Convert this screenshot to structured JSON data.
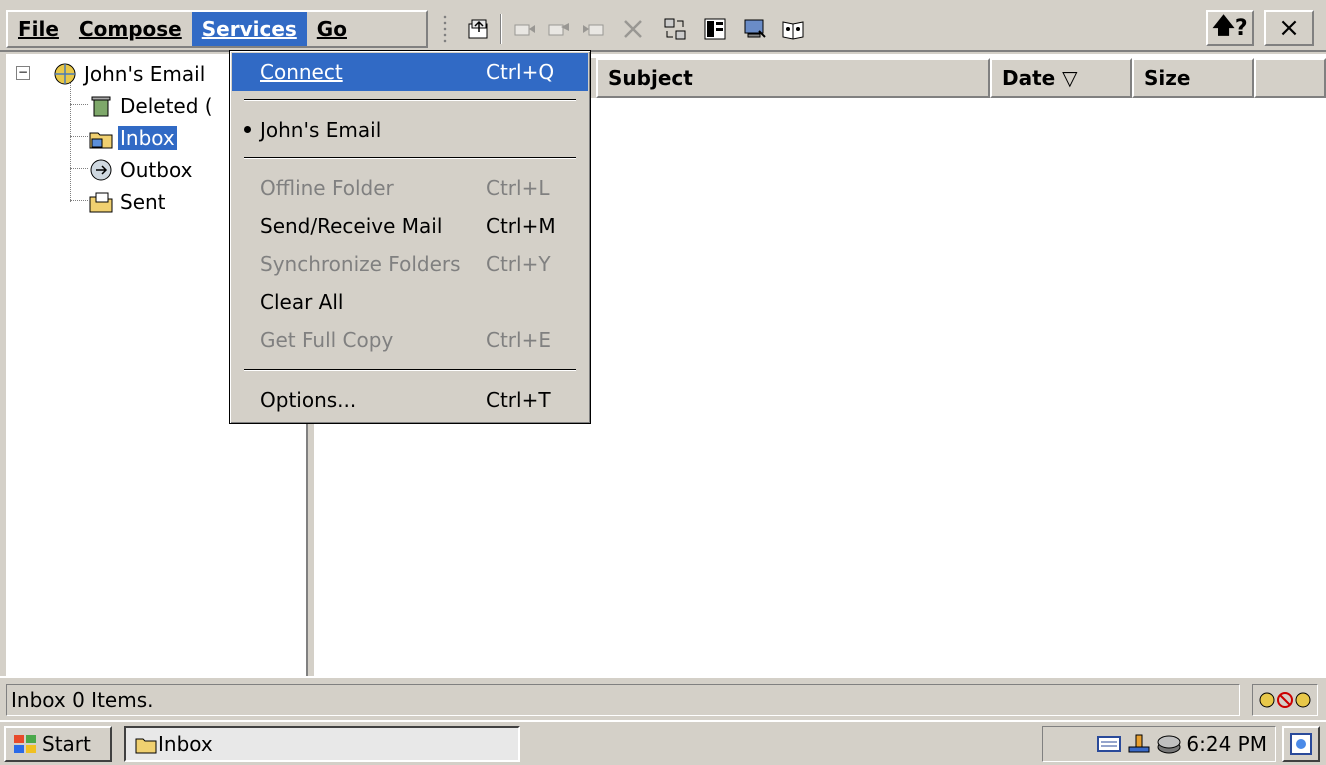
{
  "menubar": {
    "items": [
      {
        "label": "File"
      },
      {
        "label": "Compose"
      },
      {
        "label": "Services"
      },
      {
        "label": "Go"
      }
    ]
  },
  "toolbar": {
    "help_label": "?",
    "close_label": "×"
  },
  "folder_tree": {
    "account": "John's Email",
    "folders": [
      {
        "label": "Deleted ("
      },
      {
        "label": "Inbox"
      },
      {
        "label": "Outbox"
      },
      {
        "label": "Sent"
      }
    ]
  },
  "message_list": {
    "columns": [
      {
        "label": "Subject"
      },
      {
        "label": "Date ▽"
      },
      {
        "label": "Size"
      }
    ]
  },
  "services_menu": {
    "connect": {
      "label": "Connect",
      "shortcut": "Ctrl+Q"
    },
    "account": {
      "label": "John's Email"
    },
    "offline_folder": {
      "label": "Offline Folder",
      "shortcut": "Ctrl+L"
    },
    "send_receive": {
      "label": "Send/Receive Mail",
      "shortcut": "Ctrl+M"
    },
    "synchronize": {
      "label": "Synchronize Folders",
      "shortcut": "Ctrl+Y"
    },
    "clear_all": {
      "label": "Clear All"
    },
    "get_full_copy": {
      "label": "Get Full Copy",
      "shortcut": "Ctrl+E"
    },
    "options": {
      "label": "Options...",
      "shortcut": "Ctrl+T"
    }
  },
  "status": {
    "text": "Inbox 0 Items."
  },
  "taskbar": {
    "start_label": "Start",
    "task_label": "Inbox",
    "clock": "6:24 PM"
  },
  "colors": {
    "highlight": "#316ac5",
    "face": "#d4d0c8"
  }
}
